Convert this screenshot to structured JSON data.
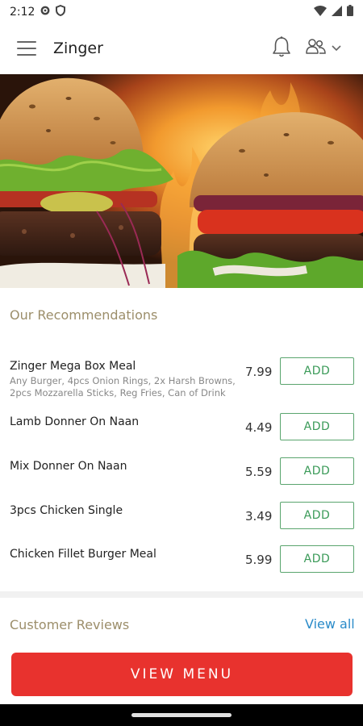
{
  "status_bar": {
    "time": "2:12",
    "icons": [
      "settings-icon",
      "shield-icon",
      "wifi-icon",
      "signal-icon",
      "battery-icon"
    ]
  },
  "app_bar": {
    "title": "Zinger",
    "icons": [
      "menu-icon",
      "bell-icon",
      "user-group-icon",
      "chevron-down-icon"
    ]
  },
  "recommendations": {
    "title": "Our Recommendations",
    "items": [
      {
        "name": "Zinger Mega Box Meal",
        "description": "Any Burger, 4pcs Onion Rings, 2x Harsh Browns, 2pcs Mozzarella Sticks, Reg Fries, Can of Drink",
        "price": "7.99",
        "add_label": "ADD"
      },
      {
        "name": "Lamb Donner On Naan",
        "price": "4.49",
        "add_label": "ADD"
      },
      {
        "name": "Mix Donner On Naan",
        "price": "5.59",
        "add_label": "ADD"
      },
      {
        "name": "3pcs Chicken Single",
        "price": "3.49",
        "add_label": "ADD"
      },
      {
        "name": "Chicken Fillet Burger Meal",
        "price": "5.99",
        "add_label": "ADD"
      }
    ]
  },
  "reviews": {
    "title": "Customer Reviews",
    "view_all": "View all"
  },
  "cta": {
    "label": "VIEW MENU"
  },
  "colors": {
    "accent_red": "#e8322e",
    "add_green": "#3a9a58",
    "section_title": "#9c8e6a",
    "link_blue": "#2a8bc9"
  }
}
